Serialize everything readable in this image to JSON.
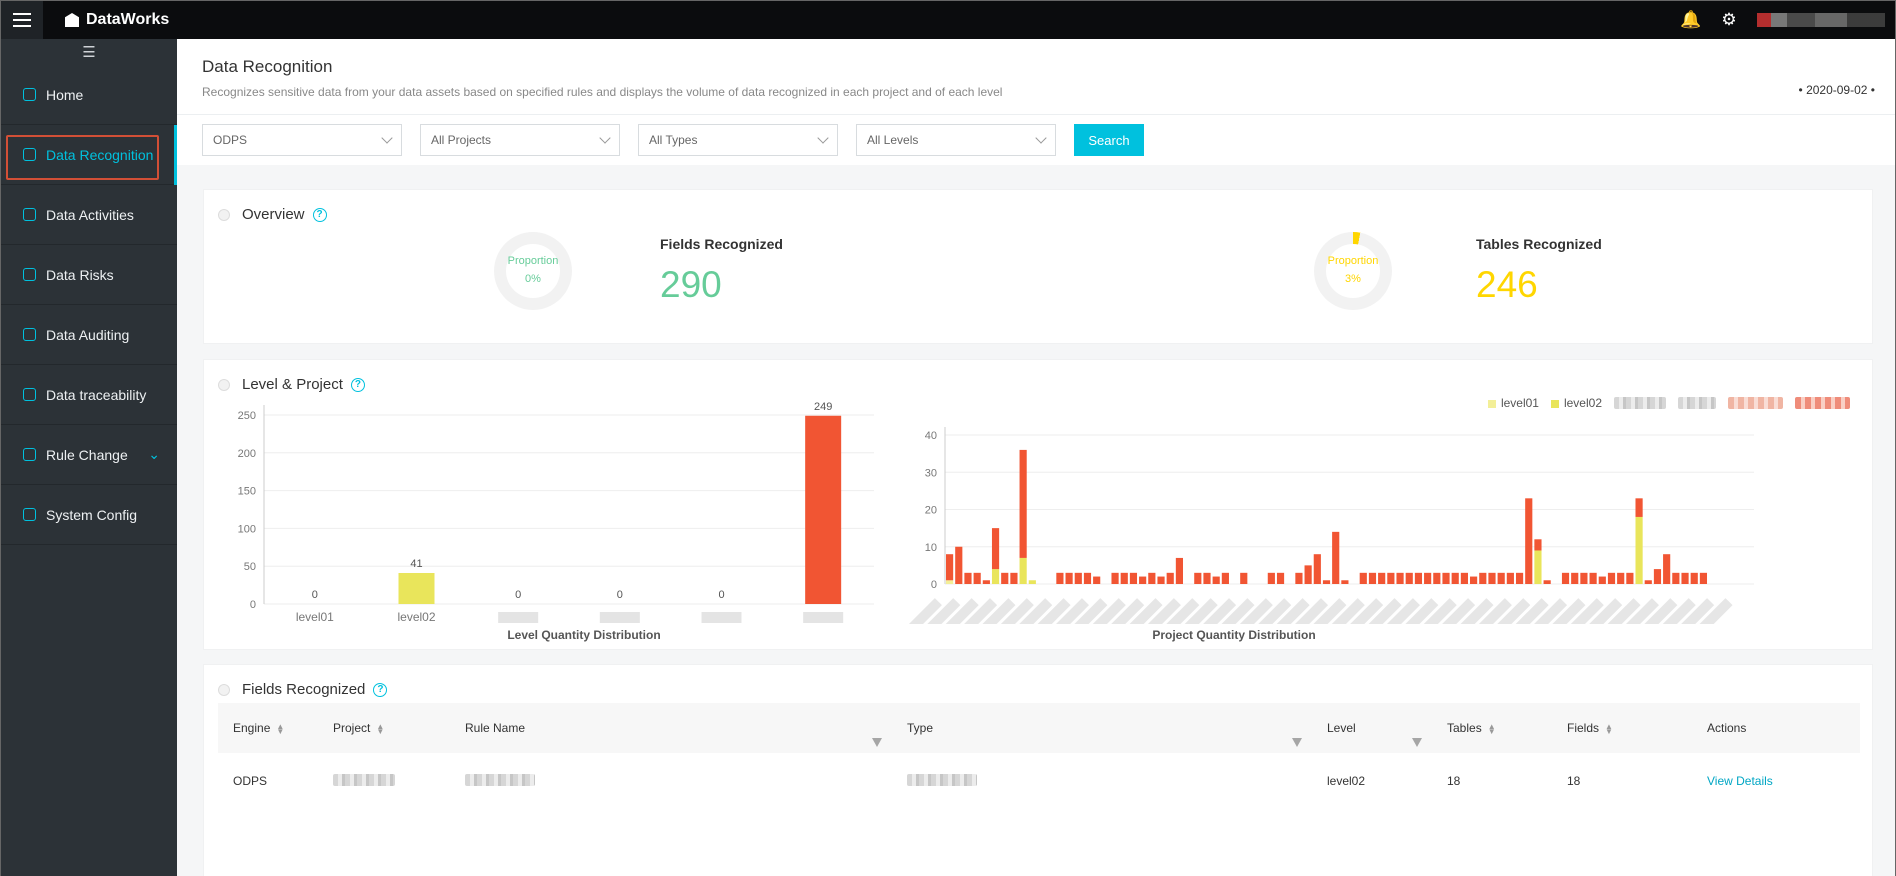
{
  "app": {
    "name": "DataWorks"
  },
  "topbar": {
    "icons": [
      "bell-icon",
      "tools-icon"
    ],
    "user": "redacted"
  },
  "sidebar": {
    "items": [
      {
        "label": "Home",
        "icon": "home-icon"
      },
      {
        "label": "Data Recognition",
        "icon": "recognition-icon",
        "active": true
      },
      {
        "label": "Data Activities",
        "icon": "activities-icon"
      },
      {
        "label": "Data Risks",
        "icon": "risks-icon"
      },
      {
        "label": "Data Auditing",
        "icon": "audit-icon"
      },
      {
        "label": "Data traceability",
        "icon": "traceability-icon"
      },
      {
        "label": "Rule Change",
        "icon": "rule-icon",
        "has_submenu": true
      },
      {
        "label": "System Config",
        "icon": "config-icon"
      }
    ]
  },
  "page": {
    "title": "Data Recognition",
    "description": "Recognizes sensitive data from your data assets based on specified rules and displays the volume of data recognized in each project and of each level",
    "date": "2020-09-02"
  },
  "filters": {
    "engine": "ODPS",
    "project": "All Projects",
    "type": "All Types",
    "level": "All Levels",
    "search_label": "Search"
  },
  "overview": {
    "title": "Overview",
    "fields": {
      "label": "Fields Recognized",
      "value": "290",
      "proportion_label": "Proportion",
      "proportion": "0%",
      "color": "#66cc99"
    },
    "tables": {
      "label": "Tables Recognized",
      "value": "246",
      "proportion_label": "Proportion",
      "proportion": "3%",
      "color": "#ffd600"
    }
  },
  "level_project": {
    "title": "Level & Project"
  },
  "chart_data": [
    {
      "type": "bar",
      "title": "Level Quantity Distribution",
      "categories": [
        "level01",
        "level02",
        "",
        "",
        "",
        ""
      ],
      "values": [
        0,
        41,
        0,
        0,
        0,
        249
      ],
      "ylim": [
        0,
        250
      ],
      "yticks": [
        0,
        50,
        100,
        150,
        200,
        250
      ],
      "colors": [
        "#e9e55b",
        "#e9e55b",
        "#e9e55b",
        "#e9e55b",
        "#e9e55b",
        "#f15533"
      ]
    },
    {
      "type": "bar",
      "title": "Project Quantity Distribution",
      "stacked": true,
      "legend": [
        "level01",
        "level02"
      ],
      "ylim": [
        0,
        40
      ],
      "yticks": [
        0,
        10,
        20,
        30,
        40
      ],
      "series": [
        {
          "name": "level01",
          "values": [
            1,
            0,
            0,
            0,
            0,
            0,
            0,
            0,
            0,
            0,
            0,
            0,
            0,
            0,
            0,
            0,
            0,
            0,
            0,
            0,
            0,
            0,
            0,
            0,
            0,
            0,
            0,
            0,
            0,
            0,
            0,
            0,
            0,
            0,
            0,
            0,
            0,
            0,
            0,
            0,
            0,
            0,
            0,
            0,
            0,
            0,
            0,
            0,
            0,
            0,
            0,
            0,
            0,
            0,
            0,
            0,
            0,
            0,
            0,
            0,
            0,
            0,
            0,
            0,
            0,
            0,
            0,
            0,
            0,
            0,
            0,
            0,
            0,
            0,
            0,
            0,
            0,
            0,
            0,
            0,
            0,
            0,
            0,
            0,
            0,
            0,
            0,
            0
          ]
        },
        {
          "name": "level02",
          "values": [
            0,
            0,
            0,
            0,
            0,
            4,
            0,
            0,
            7,
            1,
            0,
            0,
            0,
            0,
            0,
            0,
            0,
            0,
            0,
            0,
            0,
            0,
            0,
            0,
            0,
            0,
            0,
            0,
            0,
            0,
            0,
            0,
            0,
            0,
            0,
            0,
            0,
            0,
            0,
            0,
            0,
            0,
            0,
            0,
            0,
            0,
            0,
            0,
            0,
            0,
            0,
            0,
            0,
            0,
            0,
            0,
            0,
            0,
            0,
            0,
            0,
            0,
            0,
            0,
            9,
            0,
            0,
            0,
            0,
            0,
            0,
            0,
            0,
            0,
            0,
            18,
            0,
            0,
            0,
            0,
            0,
            0,
            0,
            0,
            0,
            0,
            0,
            0
          ]
        },
        {
          "name": "",
          "values": [
            7,
            10,
            3,
            3,
            1,
            11,
            3,
            3,
            29,
            0,
            0,
            0,
            3,
            3,
            3,
            3,
            2,
            0,
            3,
            3,
            3,
            2,
            3,
            2,
            3,
            7,
            0,
            3,
            3,
            2,
            3,
            0,
            3,
            0,
            0,
            3,
            3,
            0,
            3,
            5,
            8,
            1,
            14,
            1,
            0,
            3,
            3,
            3,
            3,
            3,
            3,
            3,
            3,
            3,
            3,
            3,
            3,
            2,
            3,
            3,
            3,
            3,
            3,
            23,
            3,
            1,
            0,
            3,
            3,
            3,
            3,
            2,
            3,
            3,
            3,
            5,
            1,
            4,
            8,
            3,
            3,
            3,
            3,
            0,
            0,
            0,
            0,
            0
          ]
        }
      ]
    }
  ],
  "fields_recognized": {
    "title": "Fields Recognized",
    "columns": [
      "Engine",
      "Project",
      "Rule Name",
      "Type",
      "Level",
      "Tables",
      "Fields",
      "Actions"
    ],
    "rows": [
      {
        "engine": "ODPS",
        "level": "level02",
        "tables": "18",
        "fields": "18",
        "action": "View Details"
      }
    ]
  }
}
